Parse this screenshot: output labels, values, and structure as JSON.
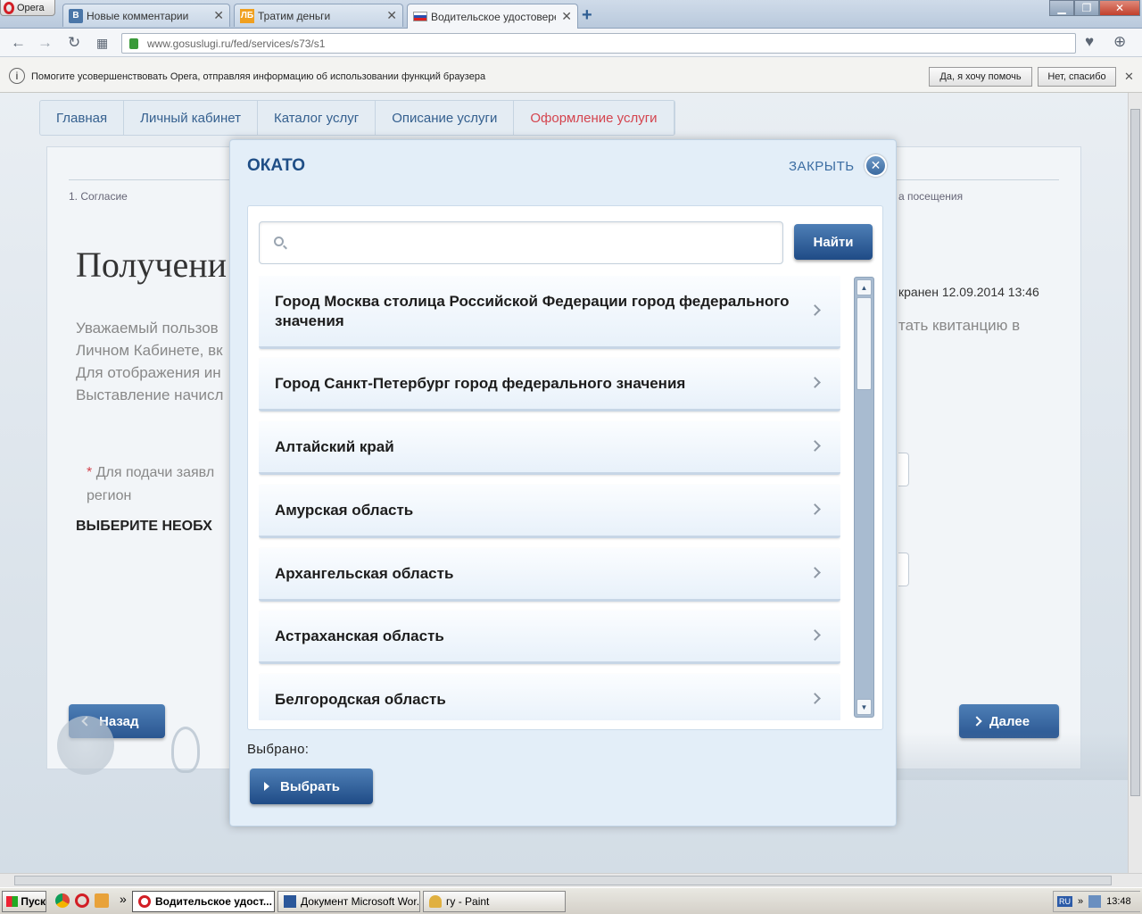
{
  "browser": {
    "menu_label": "Opera",
    "tabs": [
      {
        "label": "Новые комментарии",
        "favicon": "vk-icon"
      },
      {
        "label": "Тратим деньги",
        "favicon": "blog-icon"
      },
      {
        "label": "Водительское удостоверен",
        "favicon": "russia-flag-icon"
      }
    ],
    "url": "www.gosuslugi.ru/fed/services/s73/s1",
    "infobar": {
      "text": "Помогите усовершенствовать Opera, отправляя информацию об использовании функций браузера",
      "yes_label": "Да, я хочу помочь",
      "no_label": "Нет, спасибо"
    }
  },
  "page": {
    "breadcrumbs": [
      "Главная",
      "Личный кабинет",
      "Каталог услуг",
      "Описание услуги",
      "Оформление услуги"
    ],
    "step_first": "1. Согласие",
    "step_last_fragment": "а посещения",
    "title_fragment": "Получени",
    "saved_fragment": "кранен 12.09.2014 13:46",
    "para_lines": [
      "Уважаемый пользов",
      "Личном Кабинете, вк",
      "Для отображения ин",
      "Выставление начисл"
    ],
    "para_right_fragment": "тать квитанцию в",
    "note_star": "*",
    "note_text": "Для подачи заявл",
    "note_text2": "регион",
    "choose_heading": "ВЫБЕРИТЕ НЕОБХ",
    "back_label": "Назад",
    "next_label": "Далее"
  },
  "modal": {
    "title": "ОКАТО",
    "close_label": "ЗАКРЫТЬ",
    "search_placeholder": "",
    "find_label": "Найти",
    "items": [
      "Город Москва столица Российской Федерации город федерального значения",
      "Город Санкт-Петербург город федерального значения",
      "Алтайский край",
      "Амурская область",
      "Архангельская область",
      "Астраханская область",
      "Белгородская область"
    ],
    "selected_label": "Выбрано:",
    "choose_label": "Выбрать"
  },
  "taskbar": {
    "start_label": "Пуск",
    "tasks": [
      "Водительское удост...",
      "Документ Microsoft Wor...",
      "гу - Paint"
    ],
    "lang": "RU",
    "time": "13:48",
    "overflow": "»"
  },
  "colors": {
    "accent": "#2a5691",
    "current_crumb": "#d4444e",
    "modal_title": "#1f4e86"
  }
}
